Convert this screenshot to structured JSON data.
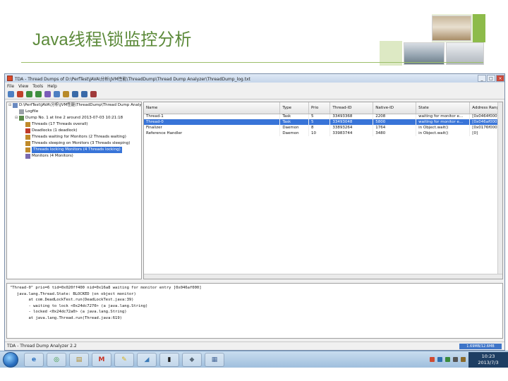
{
  "slide": {
    "title": "Java线程\\锁监控分析"
  },
  "window": {
    "title": "TDA - Thread Dumps of D:\\PerfTest\\JAVA\\分析\\JVM性能\\ThreadDump\\Thread Dump Analyzer\\ThreadDump_log.txt",
    "minimize": "_",
    "maximize": "□",
    "close": "×"
  },
  "menu": [
    "File",
    "View",
    "Tools",
    "Help"
  ],
  "toolbar_icons": [
    "open-icon",
    "close-icon",
    "expand-icon",
    "collapse-icon",
    "filter-icon",
    "settings-icon",
    "find-icon",
    "prev-icon",
    "next-icon",
    "merge-icon"
  ],
  "tree": {
    "items": [
      {
        "label": "D:\\PerfTest\\JAVA\\分析\\JVM性能\\ThreadDump\\Thread Dump Analyzer\\ThreadDump_log.txt",
        "indent": 0,
        "icon": "file-icon",
        "expander": "⊟"
      },
      {
        "label": "Logfile",
        "indent": 1,
        "icon": "doc-icon",
        "expander": ""
      },
      {
        "label": "Dump No. 1 at line 2 around 2013-07-03 10:21:18",
        "indent": 1,
        "icon": "dump-icon",
        "expander": "⊟"
      },
      {
        "label": "Threads (17 Threads overall)",
        "indent": 2,
        "icon": "threads-icon",
        "expander": ""
      },
      {
        "label": "Deadlocks (1 deadlock)",
        "indent": 2,
        "icon": "deadlock-icon",
        "expander": ""
      },
      {
        "label": "Threads waiting for Monitors (2 Threads waiting)",
        "indent": 2,
        "icon": "waiting-icon",
        "expander": ""
      },
      {
        "label": "Threads sleeping on Monitors (3 Threads sleeping)",
        "indent": 2,
        "icon": "sleeping-icon",
        "expander": ""
      },
      {
        "label": "Threads locking Monitors (4 Threads locking)",
        "indent": 2,
        "icon": "locking-icon",
        "expander": "",
        "selected": true
      },
      {
        "label": "Monitors (4 Monitors)",
        "indent": 2,
        "icon": "monitor-icon",
        "expander": ""
      }
    ]
  },
  "table": {
    "columns": [
      "Name",
      "Type",
      "Prio",
      "Thread-ID",
      "Native-ID",
      "State",
      "Address Range"
    ],
    "rows": [
      {
        "cells": [
          "Thread-1",
          "Task",
          "5",
          "33493368",
          "2208",
          "waiting for monitor e...",
          "[0x0464f000]"
        ],
        "selected": false
      },
      {
        "cells": [
          "Thread-0",
          "Task",
          "5",
          "33493048",
          "5800",
          "waiting for monitor e...",
          "[0x046af000]"
        ],
        "selected": true
      },
      {
        "cells": [
          "Finalizer",
          "Daemon",
          "8",
          "33893264",
          "1764",
          "in Object.wait()",
          "[0x0176f000]"
        ],
        "selected": false
      },
      {
        "cells": [
          "Reference Handler",
          "Daemon",
          "10",
          "33983744",
          "3480",
          "in Object.wait()",
          "[0]"
        ],
        "selected": false
      }
    ]
  },
  "detail": {
    "lines": [
      "\"Thread-0\" prio=6 tid=0x020ff400 nid=0x16a8 waiting for monitor entry [0x046af000]",
      "   java.lang.Thread.State: BLOCKED (on object monitor)",
      "        at com.DeadLockTest.run(DeadLockTest.java:39)",
      "        - waiting to lock <0x24dc7270> (a java.lang.String)",
      "        - locked <0x24dc72a0> (a java.lang.String)",
      "        at java.lang.Thread.run(Thread.java:619)"
    ]
  },
  "status": {
    "text": "TDA - Thread Dump Analyzer 2.2",
    "memory": "1.69MB/12.6MB"
  },
  "taskbar": {
    "apps": [
      {
        "name": "ie-icon",
        "glyph": "e",
        "color": "#2a6fbf"
      },
      {
        "name": "chrome-icon",
        "glyph": "◎",
        "color": "#2f8f2f"
      },
      {
        "name": "file-manager-icon",
        "glyph": "▤",
        "color": "#b08a2a"
      },
      {
        "name": "mail-icon",
        "glyph": "M",
        "color": "#c83020"
      },
      {
        "name": "notes-icon",
        "glyph": "✎",
        "color": "#d8b020"
      },
      {
        "name": "tools-icon",
        "glyph": "◢",
        "color": "#3a7ab8"
      },
      {
        "name": "console-icon",
        "glyph": "▮",
        "color": "#222222"
      },
      {
        "name": "package-icon",
        "glyph": "◆",
        "color": "#5a6a7a"
      },
      {
        "name": "document-icon",
        "glyph": "▦",
        "color": "#4a6a9a"
      }
    ],
    "clock_time": "10:23",
    "clock_date": "2013/7/3"
  }
}
